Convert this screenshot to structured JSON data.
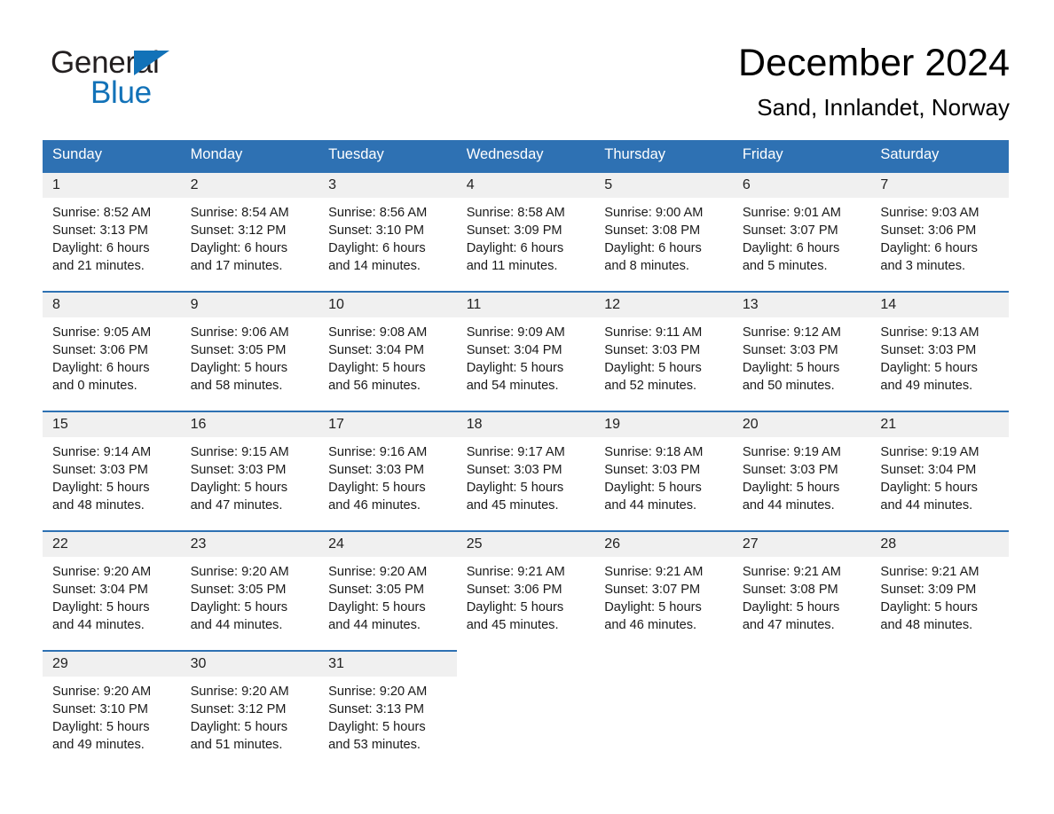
{
  "brand": {
    "name_part1": "General",
    "name_part2": "Blue",
    "triangle_color": "#1272b8",
    "text_color": "#231f20"
  },
  "header": {
    "title": "December 2024",
    "subtitle": "Sand, Innlandet, Norway",
    "accent_color": "#2e71b3",
    "daynum_band_color": "#f0f0f0"
  },
  "weekday_headers": [
    "Sunday",
    "Monday",
    "Tuesday",
    "Wednesday",
    "Thursday",
    "Friday",
    "Saturday"
  ],
  "weeks": [
    [
      {
        "day": "1",
        "sunrise": "Sunrise: 8:52 AM",
        "sunset": "Sunset: 3:13 PM",
        "daylight_line1": "Daylight: 6 hours",
        "daylight_line2": "and 21 minutes."
      },
      {
        "day": "2",
        "sunrise": "Sunrise: 8:54 AM",
        "sunset": "Sunset: 3:12 PM",
        "daylight_line1": "Daylight: 6 hours",
        "daylight_line2": "and 17 minutes."
      },
      {
        "day": "3",
        "sunrise": "Sunrise: 8:56 AM",
        "sunset": "Sunset: 3:10 PM",
        "daylight_line1": "Daylight: 6 hours",
        "daylight_line2": "and 14 minutes."
      },
      {
        "day": "4",
        "sunrise": "Sunrise: 8:58 AM",
        "sunset": "Sunset: 3:09 PM",
        "daylight_line1": "Daylight: 6 hours",
        "daylight_line2": "and 11 minutes."
      },
      {
        "day": "5",
        "sunrise": "Sunrise: 9:00 AM",
        "sunset": "Sunset: 3:08 PM",
        "daylight_line1": "Daylight: 6 hours",
        "daylight_line2": "and 8 minutes."
      },
      {
        "day": "6",
        "sunrise": "Sunrise: 9:01 AM",
        "sunset": "Sunset: 3:07 PM",
        "daylight_line1": "Daylight: 6 hours",
        "daylight_line2": "and 5 minutes."
      },
      {
        "day": "7",
        "sunrise": "Sunrise: 9:03 AM",
        "sunset": "Sunset: 3:06 PM",
        "daylight_line1": "Daylight: 6 hours",
        "daylight_line2": "and 3 minutes."
      }
    ],
    [
      {
        "day": "8",
        "sunrise": "Sunrise: 9:05 AM",
        "sunset": "Sunset: 3:06 PM",
        "daylight_line1": "Daylight: 6 hours",
        "daylight_line2": "and 0 minutes."
      },
      {
        "day": "9",
        "sunrise": "Sunrise: 9:06 AM",
        "sunset": "Sunset: 3:05 PM",
        "daylight_line1": "Daylight: 5 hours",
        "daylight_line2": "and 58 minutes."
      },
      {
        "day": "10",
        "sunrise": "Sunrise: 9:08 AM",
        "sunset": "Sunset: 3:04 PM",
        "daylight_line1": "Daylight: 5 hours",
        "daylight_line2": "and 56 minutes."
      },
      {
        "day": "11",
        "sunrise": "Sunrise: 9:09 AM",
        "sunset": "Sunset: 3:04 PM",
        "daylight_line1": "Daylight: 5 hours",
        "daylight_line2": "and 54 minutes."
      },
      {
        "day": "12",
        "sunrise": "Sunrise: 9:11 AM",
        "sunset": "Sunset: 3:03 PM",
        "daylight_line1": "Daylight: 5 hours",
        "daylight_line2": "and 52 minutes."
      },
      {
        "day": "13",
        "sunrise": "Sunrise: 9:12 AM",
        "sunset": "Sunset: 3:03 PM",
        "daylight_line1": "Daylight: 5 hours",
        "daylight_line2": "and 50 minutes."
      },
      {
        "day": "14",
        "sunrise": "Sunrise: 9:13 AM",
        "sunset": "Sunset: 3:03 PM",
        "daylight_line1": "Daylight: 5 hours",
        "daylight_line2": "and 49 minutes."
      }
    ],
    [
      {
        "day": "15",
        "sunrise": "Sunrise: 9:14 AM",
        "sunset": "Sunset: 3:03 PM",
        "daylight_line1": "Daylight: 5 hours",
        "daylight_line2": "and 48 minutes."
      },
      {
        "day": "16",
        "sunrise": "Sunrise: 9:15 AM",
        "sunset": "Sunset: 3:03 PM",
        "daylight_line1": "Daylight: 5 hours",
        "daylight_line2": "and 47 minutes."
      },
      {
        "day": "17",
        "sunrise": "Sunrise: 9:16 AM",
        "sunset": "Sunset: 3:03 PM",
        "daylight_line1": "Daylight: 5 hours",
        "daylight_line2": "and 46 minutes."
      },
      {
        "day": "18",
        "sunrise": "Sunrise: 9:17 AM",
        "sunset": "Sunset: 3:03 PM",
        "daylight_line1": "Daylight: 5 hours",
        "daylight_line2": "and 45 minutes."
      },
      {
        "day": "19",
        "sunrise": "Sunrise: 9:18 AM",
        "sunset": "Sunset: 3:03 PM",
        "daylight_line1": "Daylight: 5 hours",
        "daylight_line2": "and 44 minutes."
      },
      {
        "day": "20",
        "sunrise": "Sunrise: 9:19 AM",
        "sunset": "Sunset: 3:03 PM",
        "daylight_line1": "Daylight: 5 hours",
        "daylight_line2": "and 44 minutes."
      },
      {
        "day": "21",
        "sunrise": "Sunrise: 9:19 AM",
        "sunset": "Sunset: 3:04 PM",
        "daylight_line1": "Daylight: 5 hours",
        "daylight_line2": "and 44 minutes."
      }
    ],
    [
      {
        "day": "22",
        "sunrise": "Sunrise: 9:20 AM",
        "sunset": "Sunset: 3:04 PM",
        "daylight_line1": "Daylight: 5 hours",
        "daylight_line2": "and 44 minutes."
      },
      {
        "day": "23",
        "sunrise": "Sunrise: 9:20 AM",
        "sunset": "Sunset: 3:05 PM",
        "daylight_line1": "Daylight: 5 hours",
        "daylight_line2": "and 44 minutes."
      },
      {
        "day": "24",
        "sunrise": "Sunrise: 9:20 AM",
        "sunset": "Sunset: 3:05 PM",
        "daylight_line1": "Daylight: 5 hours",
        "daylight_line2": "and 44 minutes."
      },
      {
        "day": "25",
        "sunrise": "Sunrise: 9:21 AM",
        "sunset": "Sunset: 3:06 PM",
        "daylight_line1": "Daylight: 5 hours",
        "daylight_line2": "and 45 minutes."
      },
      {
        "day": "26",
        "sunrise": "Sunrise: 9:21 AM",
        "sunset": "Sunset: 3:07 PM",
        "daylight_line1": "Daylight: 5 hours",
        "daylight_line2": "and 46 minutes."
      },
      {
        "day": "27",
        "sunrise": "Sunrise: 9:21 AM",
        "sunset": "Sunset: 3:08 PM",
        "daylight_line1": "Daylight: 5 hours",
        "daylight_line2": "and 47 minutes."
      },
      {
        "day": "28",
        "sunrise": "Sunrise: 9:21 AM",
        "sunset": "Sunset: 3:09 PM",
        "daylight_line1": "Daylight: 5 hours",
        "daylight_line2": "and 48 minutes."
      }
    ],
    [
      {
        "day": "29",
        "sunrise": "Sunrise: 9:20 AM",
        "sunset": "Sunset: 3:10 PM",
        "daylight_line1": "Daylight: 5 hours",
        "daylight_line2": "and 49 minutes."
      },
      {
        "day": "30",
        "sunrise": "Sunrise: 9:20 AM",
        "sunset": "Sunset: 3:12 PM",
        "daylight_line1": "Daylight: 5 hours",
        "daylight_line2": "and 51 minutes."
      },
      {
        "day": "31",
        "sunrise": "Sunrise: 9:20 AM",
        "sunset": "Sunset: 3:13 PM",
        "daylight_line1": "Daylight: 5 hours",
        "daylight_line2": "and 53 minutes."
      },
      {
        "day": "",
        "sunrise": "",
        "sunset": "",
        "daylight_line1": "",
        "daylight_line2": ""
      },
      {
        "day": "",
        "sunrise": "",
        "sunset": "",
        "daylight_line1": "",
        "daylight_line2": ""
      },
      {
        "day": "",
        "sunrise": "",
        "sunset": "",
        "daylight_line1": "",
        "daylight_line2": ""
      },
      {
        "day": "",
        "sunrise": "",
        "sunset": "",
        "daylight_line1": "",
        "daylight_line2": ""
      }
    ]
  ]
}
